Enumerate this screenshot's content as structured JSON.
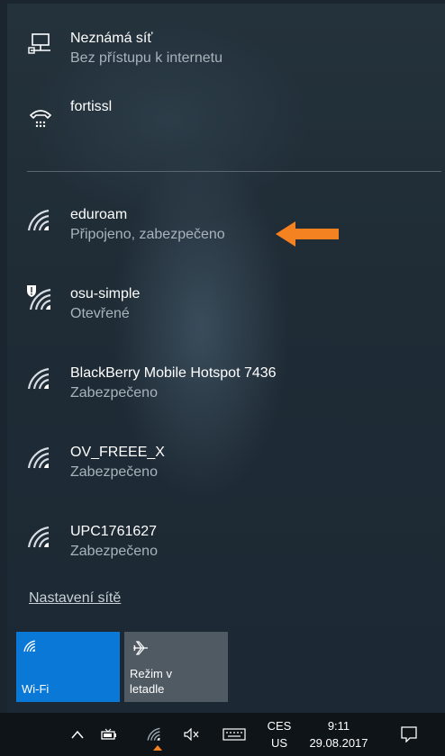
{
  "networks_top": [
    {
      "name": "Neznámá síť",
      "status": "Bez přístupu k internetu",
      "icon": "wired-monitor-icon"
    },
    {
      "name": "fortissl",
      "status": "",
      "icon": "dialup-phone-icon"
    }
  ],
  "networks": [
    {
      "name": "eduroam",
      "status": "Připojeno, zabezpečeno",
      "icon": "wifi-icon"
    },
    {
      "name": "osu-simple",
      "status": "Otevřené",
      "icon": "wifi-shield-icon"
    },
    {
      "name": "BlackBerry Mobile Hotspot 7436",
      "status": "Zabezpečeno",
      "icon": "wifi-icon"
    },
    {
      "name": "OV_FREEE_X",
      "status": "Zabezpečeno",
      "icon": "wifi-icon"
    },
    {
      "name": "UPC1761627",
      "status": "Zabezpečeno",
      "icon": "wifi-icon"
    }
  ],
  "settings_link": "Nastavení sítě",
  "tiles": {
    "wifi_label": "Wi-Fi",
    "airplane_label_line1": "Režim v",
    "airplane_label_line2": "letadle"
  },
  "taskbar": {
    "lang_top": "CES",
    "lang_bottom": "US",
    "time": "9:11",
    "date": "29.08.2017"
  },
  "colors": {
    "accent": "#0a78d7",
    "arrow": "#f58220",
    "secondary_text": "#a8b3bb"
  }
}
